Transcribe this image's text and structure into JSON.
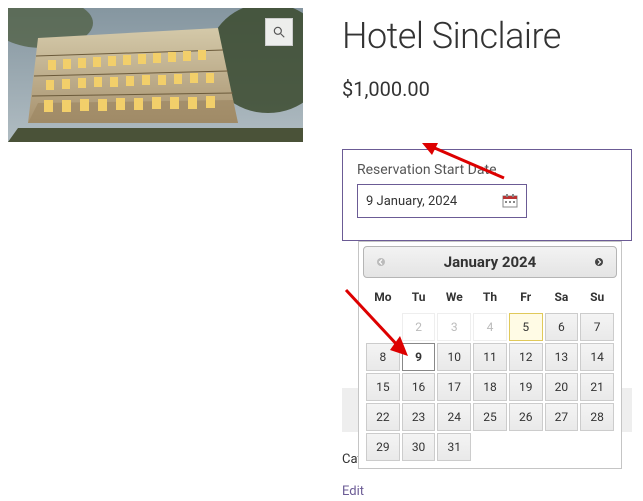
{
  "product": {
    "title": "Hotel Sinclaire",
    "price": "$1,000.00"
  },
  "reservation": {
    "label": "Reservation Start Date",
    "value": "9 January, 2024"
  },
  "calendar": {
    "month_year": "January 2024",
    "dow": [
      "Mo",
      "Tu",
      "We",
      "Th",
      "Fr",
      "Sa",
      "Su"
    ],
    "weeks": [
      [
        {
          "n": "",
          "s": "blank"
        },
        {
          "n": "2",
          "s": "muted"
        },
        {
          "n": "3",
          "s": "muted"
        },
        {
          "n": "4",
          "s": "muted"
        },
        {
          "n": "5",
          "s": "today"
        },
        {
          "n": "6",
          "s": ""
        },
        {
          "n": "7",
          "s": ""
        }
      ],
      [
        {
          "n": "8",
          "s": ""
        },
        {
          "n": "9",
          "s": "selected"
        },
        {
          "n": "10",
          "s": ""
        },
        {
          "n": "11",
          "s": ""
        },
        {
          "n": "12",
          "s": ""
        },
        {
          "n": "13",
          "s": ""
        },
        {
          "n": "14",
          "s": ""
        }
      ],
      [
        {
          "n": "15",
          "s": ""
        },
        {
          "n": "16",
          "s": ""
        },
        {
          "n": "17",
          "s": ""
        },
        {
          "n": "18",
          "s": ""
        },
        {
          "n": "19",
          "s": ""
        },
        {
          "n": "20",
          "s": ""
        },
        {
          "n": "21",
          "s": ""
        }
      ],
      [
        {
          "n": "22",
          "s": ""
        },
        {
          "n": "23",
          "s": ""
        },
        {
          "n": "24",
          "s": ""
        },
        {
          "n": "25",
          "s": ""
        },
        {
          "n": "26",
          "s": ""
        },
        {
          "n": "27",
          "s": ""
        },
        {
          "n": "28",
          "s": ""
        }
      ],
      [
        {
          "n": "29",
          "s": ""
        },
        {
          "n": "30",
          "s": ""
        },
        {
          "n": "31",
          "s": ""
        },
        {
          "n": "",
          "s": "blank"
        },
        {
          "n": "",
          "s": "blank"
        },
        {
          "n": "",
          "s": "blank"
        },
        {
          "n": "",
          "s": "blank"
        }
      ]
    ]
  },
  "meta": {
    "cat_prefix": "Cat",
    "edit_prefix": "Edit"
  }
}
